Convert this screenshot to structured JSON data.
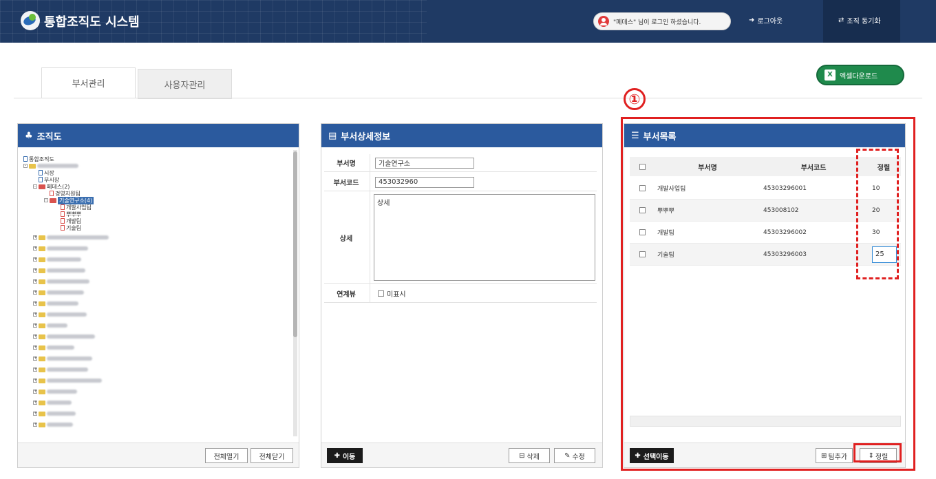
{
  "header": {
    "app_title": "통합조직도 시스템",
    "login_message": "\"페데스\" 님이 로그인 하셨습니다.",
    "logout_label": "로그아웃",
    "sync_label": "조직 동기화"
  },
  "tabs": [
    {
      "label": "부서관리",
      "active": true
    },
    {
      "label": "사용자관리",
      "active": false
    }
  ],
  "excel_button": "엑셀다운로드",
  "annotation_number": "①",
  "org_panel": {
    "title": "조직도",
    "tree": {
      "root": "통합조직도",
      "level2_items": [
        "시장",
        "부시장"
      ],
      "group": "페데스(2)",
      "child1": "경영지원팀",
      "selected": "기술연구소(4)",
      "sub_items": [
        "개발사업팀",
        "뿌뿌뿌",
        "개발팀",
        "기술팀"
      ]
    },
    "expand_all": "전체열기",
    "collapse_all": "전체닫기"
  },
  "detail_panel": {
    "title": "부서상세정보",
    "fields": {
      "name_label": "부서명",
      "name_value": "기술연구소",
      "code_label": "부서코드",
      "code_value": "453032960",
      "detail_label": "상세",
      "detail_value": "상세",
      "view_label": "연계뷰",
      "view_option": "미표시"
    },
    "move_button": "이동",
    "delete_button": "삭제",
    "edit_button": "수정"
  },
  "list_panel": {
    "title": "부서목록",
    "columns": [
      "부서명",
      "부서코드",
      "정렬"
    ],
    "rows": [
      {
        "name": "개발사업팀",
        "code": "45303296001",
        "sort": "10"
      },
      {
        "name": "뿌뿌뿌",
        "code": "453008102",
        "sort": "20"
      },
      {
        "name": "개발팀",
        "code": "45303296002",
        "sort": "30"
      },
      {
        "name": "기술팀",
        "code": "45303296003",
        "sort": "25"
      }
    ],
    "move_selected_button": "선택이동",
    "add_team_button": "팀추가",
    "sort_button": "정렬"
  },
  "colors": {
    "header_bg": "#1f3a64",
    "panel_head": "#2b5a9e",
    "annotation": "#e02020",
    "excel_green": "#1f8a4c"
  }
}
